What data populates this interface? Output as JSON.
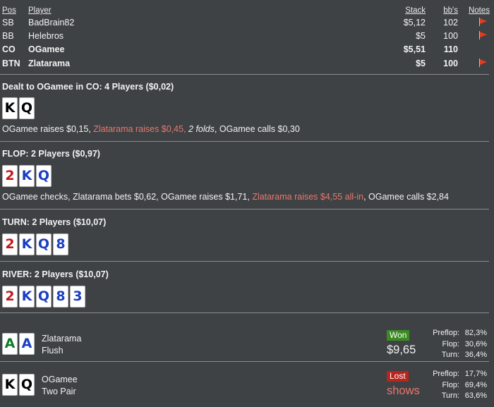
{
  "header": {
    "pos": "Pos",
    "player": "Player",
    "stack": "Stack",
    "bbs": "bb's",
    "notes": "Notes"
  },
  "players": [
    {
      "pos": "SB",
      "name": "BadBrain82",
      "stack": "$5,12",
      "bbs": "102",
      "flag": true,
      "bold": false
    },
    {
      "pos": "BB",
      "name": "Helebros",
      "stack": "$5",
      "bbs": "100",
      "flag": true,
      "bold": false
    },
    {
      "pos": "CO",
      "name": "OGamee",
      "stack": "$5,51",
      "bbs": "110",
      "flag": false,
      "bold": true
    },
    {
      "pos": "BTN",
      "name": "Zlatarama",
      "stack": "$5",
      "bbs": "100",
      "flag": true,
      "bold": true
    }
  ],
  "preflop": {
    "title": "Dealt to OGamee in CO: 4 Players ($0,02)",
    "cards": [
      {
        "r": "K",
        "s": "s"
      },
      {
        "r": "Q",
        "s": "s"
      }
    ],
    "actions": [
      {
        "t": "OGamee raises $0,15, ",
        "c": ""
      },
      {
        "t": "Zlatarama raises $0,45, ",
        "c": "red"
      },
      {
        "t": "2 folds",
        "c": "it"
      },
      {
        "t": ", OGamee calls $0,30",
        "c": ""
      }
    ]
  },
  "flop": {
    "title": "FLOP: 2 Players ($0,97)",
    "cards": [
      {
        "r": "2",
        "s": "h"
      },
      {
        "r": "K",
        "s": "d"
      },
      {
        "r": "Q",
        "s": "d"
      }
    ],
    "actions": [
      {
        "t": "OGamee checks, Zlatarama bets $0,62, OGamee raises $1,71, ",
        "c": ""
      },
      {
        "t": "Zlatarama raises $4,55 all-in",
        "c": "red"
      },
      {
        "t": ", OGamee calls $2,84",
        "c": ""
      }
    ]
  },
  "turn": {
    "title": "TURN: 2 Players ($10,07)",
    "cards": [
      {
        "r": "2",
        "s": "h"
      },
      {
        "r": "K",
        "s": "d"
      },
      {
        "r": "Q",
        "s": "d"
      },
      {
        "r": "8",
        "s": "d"
      }
    ]
  },
  "river": {
    "title": "RIVER: 2 Players ($10,07)",
    "cards": [
      {
        "r": "2",
        "s": "h"
      },
      {
        "r": "K",
        "s": "d"
      },
      {
        "r": "Q",
        "s": "d"
      },
      {
        "r": "8",
        "s": "d"
      },
      {
        "r": "3",
        "s": "d"
      }
    ]
  },
  "results": [
    {
      "name": "Zlatarama",
      "hand": "Flush",
      "cards": [
        {
          "r": "A",
          "s": "c"
        },
        {
          "r": "A",
          "s": "d"
        }
      ],
      "badge": "Won",
      "badge_type": "won",
      "amount": "$9,65",
      "eq": [
        {
          "k": "Preflop:",
          "v": "82,3%"
        },
        {
          "k": "Flop:",
          "v": "30,6%"
        },
        {
          "k": "Turn:",
          "v": "36,4%"
        }
      ]
    },
    {
      "name": "OGamee",
      "hand": "Two Pair",
      "cards": [
        {
          "r": "K",
          "s": "s"
        },
        {
          "r": "Q",
          "s": "s"
        }
      ],
      "badge": "Lost",
      "badge_type": "lost",
      "amount": "shows",
      "eq": [
        {
          "k": "Preflop:",
          "v": "17,7%"
        },
        {
          "k": "Flop:",
          "v": "69,4%"
        },
        {
          "k": "Turn:",
          "v": "63,6%"
        }
      ]
    }
  ]
}
